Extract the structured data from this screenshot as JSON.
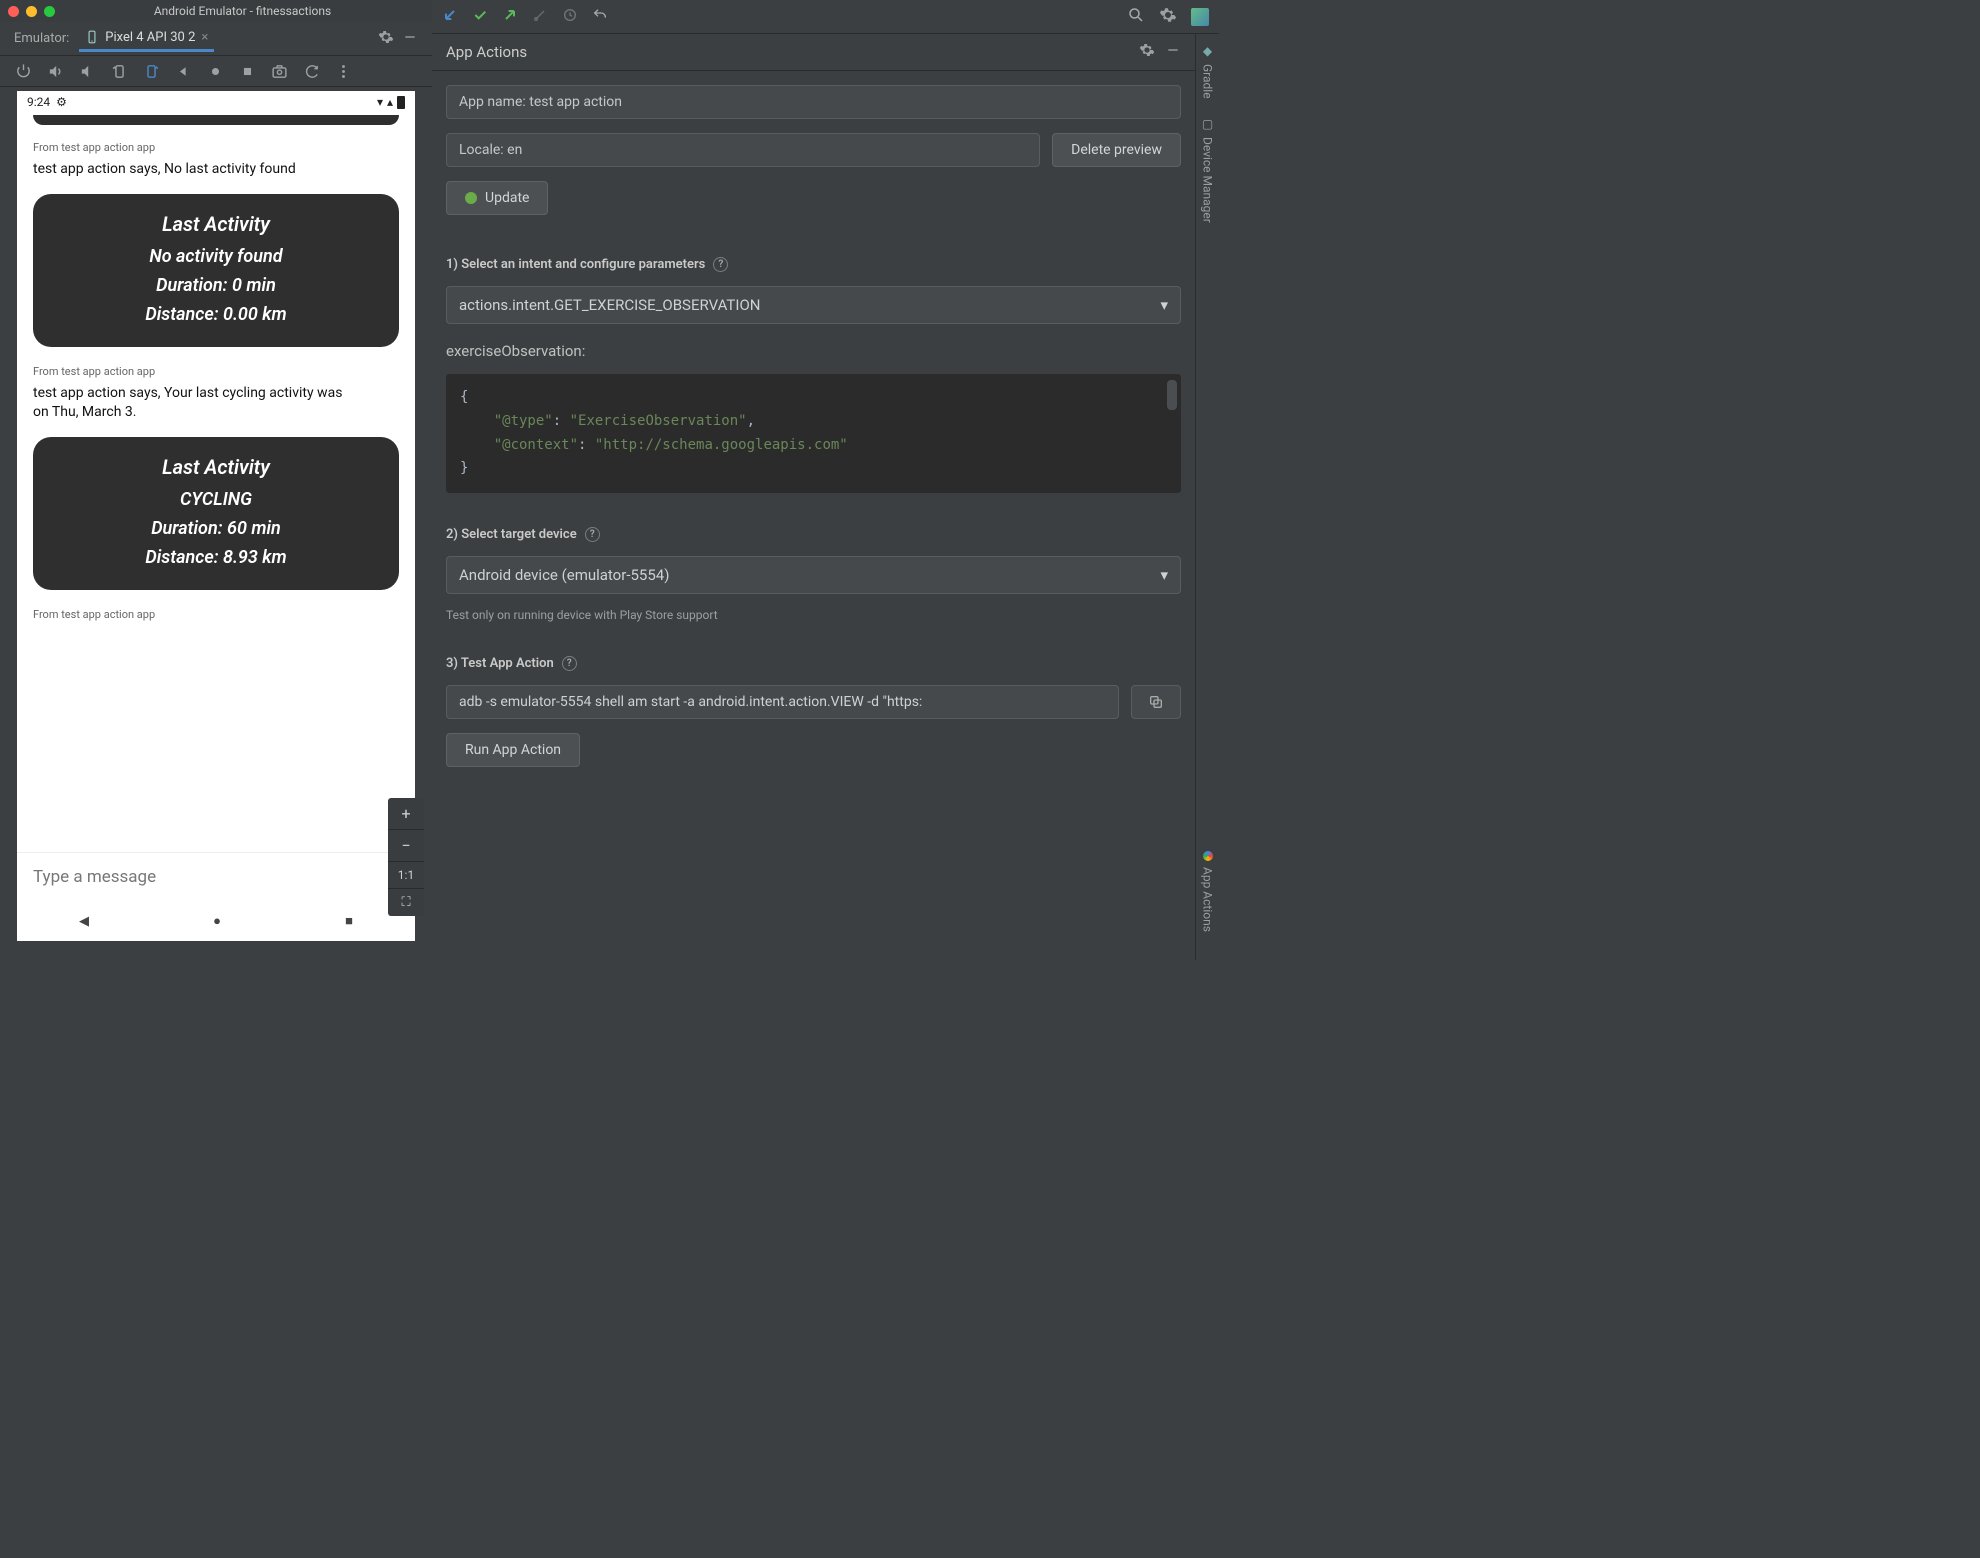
{
  "emulator": {
    "window_title": "Android Emulator - fitnessactions",
    "tab_prefix": "Emulator:",
    "tab_label": "Pixel 4 API 30 2"
  },
  "phone": {
    "clock": "9:24",
    "messages": [
      {
        "from": "From test app action app",
        "reply": "test app action says, No last activity found",
        "card": {
          "title": "Last Activity",
          "line1": "No activity found",
          "line2": "Duration: 0 min",
          "line3": "Distance: 0.00 km"
        }
      },
      {
        "from": "From test app action app",
        "reply": "test app action says, Your last cycling activity was on Thu, March 3.",
        "card": {
          "title": "Last Activity",
          "line1": "CYCLING",
          "line2": "Duration: 60 min",
          "line3": "Distance: 8.93 km"
        }
      }
    ],
    "trailing_from": "From test app action app",
    "input_placeholder": "Type a message",
    "zoom": {
      "plus": "+",
      "minus": "−",
      "fit": "1:1",
      "expand": "⛶"
    }
  },
  "app_actions": {
    "header": "App Actions",
    "app_name_field": "App name: test app action",
    "locale_field": "Locale: en",
    "delete_btn": "Delete preview",
    "update_btn": "Update",
    "step1_label": "1) Select an intent and configure parameters",
    "intent_value": "actions.intent.GET_EXERCISE_OBSERVATION",
    "param_label": "exerciseObservation:",
    "code": "{\n    \"@type\": \"ExerciseObservation\",\n    \"@context\": \"http://schema.googleapis.com\"\n}",
    "step2_label": "2) Select target device",
    "device_value": "Android device (emulator-5554)",
    "device_helper": "Test only on running device with Play Store support",
    "step3_label": "3) Test App Action",
    "adb_cmd": "adb -s emulator-5554 shell am start -a android.intent.action.VIEW -d \"https:",
    "run_btn": "Run App Action"
  },
  "side_rail": {
    "item1": "Gradle",
    "item2": "Device Manager",
    "item3": "App Actions"
  }
}
